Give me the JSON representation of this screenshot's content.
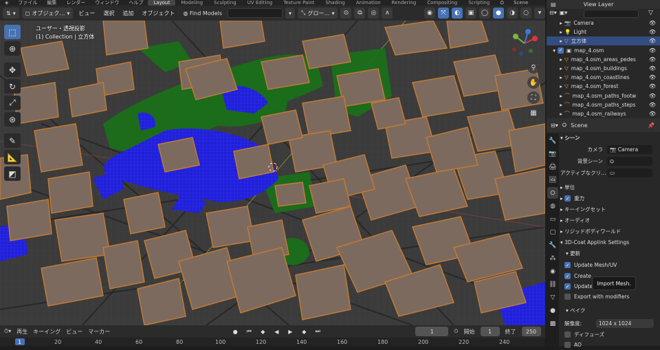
{
  "top_menu": [
    "ファイル",
    "編集",
    "レンダー",
    "ウィンドウ",
    "ヘルプ"
  ],
  "workspaces": [
    "Layout",
    "Modeling",
    "Sculpting",
    "UV Editing",
    "Texture Paint",
    "Shading",
    "Animation",
    "Rendering",
    "Compositing",
    "Scripting"
  ],
  "active_workspace": "Layout",
  "scene_name": "Scene",
  "view_layer": "View Layer",
  "viewport_header": {
    "mode": "オブジェク…",
    "menus": [
      "ビュー",
      "選択",
      "追加",
      "オブジェクト"
    ],
    "find_models": "Find Models",
    "transform_orientation": "グロー…"
  },
  "viewport": {
    "view_name": "ユーザー・透視投影",
    "collection_info": "(1) Collection | 立方体"
  },
  "outliner": {
    "items": [
      {
        "label": "Camera",
        "indent": 2,
        "icon": "camera-icon",
        "selected": false
      },
      {
        "label": "Light",
        "indent": 2,
        "icon": "light-icon",
        "selected": false
      },
      {
        "label": "立方体",
        "indent": 2,
        "icon": "mesh-icon",
        "selected": true
      },
      {
        "label": "map_4.osm",
        "indent": 1,
        "icon": "collection-icon",
        "selected": false
      },
      {
        "label": "map_4.osm_areas_pedes",
        "indent": 2,
        "icon": "mesh-icon",
        "selected": false
      },
      {
        "label": "map_4.osm_buildings",
        "indent": 2,
        "icon": "mesh-icon",
        "selected": false
      },
      {
        "label": "map_4.osm_coastlines",
        "indent": 2,
        "icon": "mesh-icon",
        "selected": false
      },
      {
        "label": "map_4.osm_forest",
        "indent": 2,
        "icon": "mesh-icon",
        "selected": false
      },
      {
        "label": "map_4.osm_paths_footw",
        "indent": 2,
        "icon": "curve-icon",
        "selected": false
      },
      {
        "label": "map_4.osm_paths_steps",
        "indent": 2,
        "icon": "curve-icon",
        "selected": false
      },
      {
        "label": "map_4.osm_railways",
        "indent": 2,
        "icon": "curve-icon",
        "selected": false
      }
    ]
  },
  "properties": {
    "context": "Scene",
    "scene_panel": "シーン",
    "camera_label": "カメラ",
    "camera_value": "Camera",
    "bg_scene_label": "背景シーン",
    "active_clip_label": "アクティブなクリ…",
    "sections": [
      "単位",
      "重力",
      "キーイングセット",
      "オーディオ",
      "リジッドボディワールド"
    ],
    "applink_title": "3D-Coat Applink Settings",
    "update_label": "更新",
    "checkboxes": [
      {
        "label": "Update Mesh/UV",
        "checked": true
      },
      {
        "label": "Create",
        "checked": true
      },
      {
        "label": "Update",
        "checked": true
      },
      {
        "label": "Export with modifiers",
        "checked": false
      }
    ],
    "bake_label": "ベイク",
    "resolution_label": "解像度:",
    "resolution_value": "1024 x 1024",
    "diffuse_label": "ディフューズ",
    "ao_label": "AO"
  },
  "tooltip": "Import Mesh.",
  "timeline": {
    "menus": [
      "再生",
      "キーイング",
      "ビュー",
      "マーカー"
    ],
    "current_frame": "1",
    "start_label": "開始",
    "start_value": "1",
    "end_label": "終了",
    "end_value": "250",
    "ruler_ticks": [
      "1",
      "20",
      "40",
      "60",
      "80",
      "100",
      "120",
      "140",
      "160",
      "180",
      "200",
      "220",
      "240"
    ]
  },
  "colors": {
    "accent": "#4772b3",
    "building": "#7d6a5e",
    "building_edge": "#c17a35",
    "water": "#1f1fd1",
    "forest": "#1a7a1a",
    "ground": "#3a3a3a"
  }
}
